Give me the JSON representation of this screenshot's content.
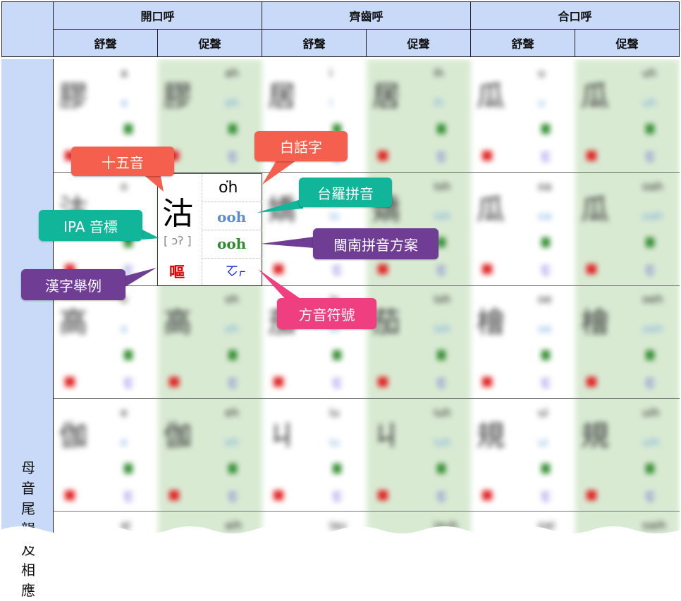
{
  "header": {
    "groups": [
      "開口呼",
      "齊齒呼",
      "合口呼"
    ],
    "sub": [
      "舒聲",
      "促聲",
      "舒聲",
      "促聲",
      "舒聲",
      "促聲"
    ]
  },
  "side_label": "母音尾韻及相應",
  "highlight": {
    "han": "沽",
    "ipa": "[ ɔʔ ]",
    "example": "嘔",
    "poj": "o͘h",
    "tailo": "ooh",
    "bp": "ooh",
    "zhuyin": "ㆦㆷ"
  },
  "callouts": {
    "fifteen": "十五音",
    "poj": "白話字",
    "tailo": "台羅拼音",
    "ipa": "IPA 音標",
    "bp": "閩南拼音方案",
    "example": "漢字舉例",
    "zhuyin": "方音符號"
  },
  "blurred_cells": [
    {
      "h": "膠",
      "r": "a"
    },
    {
      "h": "膠",
      "r": "ah"
    },
    {
      "h": "居",
      "r": "i"
    },
    {
      "h": "居",
      "r": "ih"
    },
    {
      "h": "瓜",
      "r": "u"
    },
    {
      "h": "瓜",
      "r": "uh"
    },
    {
      "h": "沽",
      "r": "o"
    },
    {
      "h": "",
      "r": ""
    },
    {
      "h": "嬌",
      "r": "io"
    },
    {
      "h": "嬌",
      "r": "ioh"
    },
    {
      "h": "瓜",
      "r": "oa"
    },
    {
      "h": "瓜",
      "r": "oah"
    },
    {
      "h": "高",
      "r": "o"
    },
    {
      "h": "高",
      "r": "oh"
    },
    {
      "h": "茄",
      "r": "io"
    },
    {
      "h": "茄",
      "r": "ioh"
    },
    {
      "h": "檜",
      "r": "oe"
    },
    {
      "h": "檜",
      "r": "oeh"
    },
    {
      "h": "伽",
      "r": "e"
    },
    {
      "h": "伽",
      "r": "eh"
    },
    {
      "h": "ㄐ",
      "r": "iu"
    },
    {
      "h": "ㄐ",
      "r": "iuh"
    },
    {
      "h": "規",
      "r": "ui"
    },
    {
      "h": "規",
      "r": "uih"
    },
    {
      "h": "",
      "r": "ai"
    },
    {
      "h": "",
      "r": "aih"
    },
    {
      "h": "",
      "r": "iau"
    },
    {
      "h": "",
      "r": "iauh"
    },
    {
      "h": "",
      "r": "oai"
    },
    {
      "h": "",
      "r": "oaih"
    }
  ]
}
